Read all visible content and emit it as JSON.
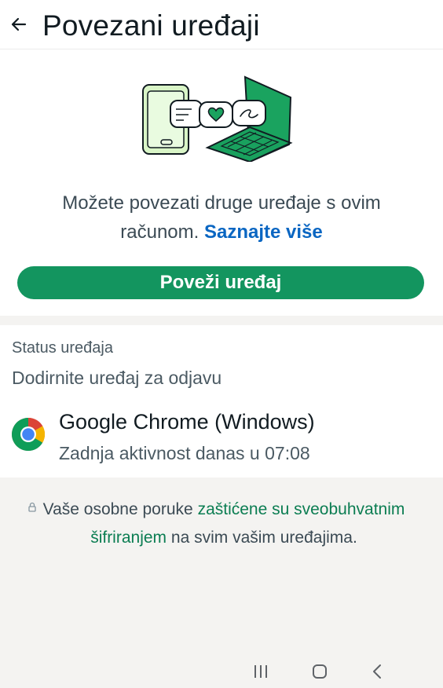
{
  "header": {
    "title": "Povezani uređaji",
    "back_icon": "arrow-left-icon"
  },
  "intro": {
    "text": "Možete povezati druge uređaje s ovim računom.",
    "link_text": "Saznajte više",
    "button_label": "Poveži uređaj"
  },
  "devices": {
    "section_title": "Status uređaja",
    "hint": "Dodirnite uređaj za odjavu",
    "items": [
      {
        "name": "Google Chrome (Windows)",
        "status": "Zadnja aktivnost danas u 07:08",
        "icon": "chrome-icon"
      }
    ]
  },
  "encryption": {
    "text_before": "Vaše osobne poruke",
    "link_text": "zaštićene su sveobuhvatnim šifriranjem",
    "text_after": "na svim vašim uređajima.",
    "icon": "lock-icon"
  },
  "nav": {
    "icons": [
      "recent-apps-icon",
      "home-icon",
      "back-icon"
    ]
  },
  "colors": {
    "accent": "#13955f",
    "link_blue": "#0a66c2",
    "link_green": "#0b7d52",
    "background": "#f4f3f1"
  }
}
